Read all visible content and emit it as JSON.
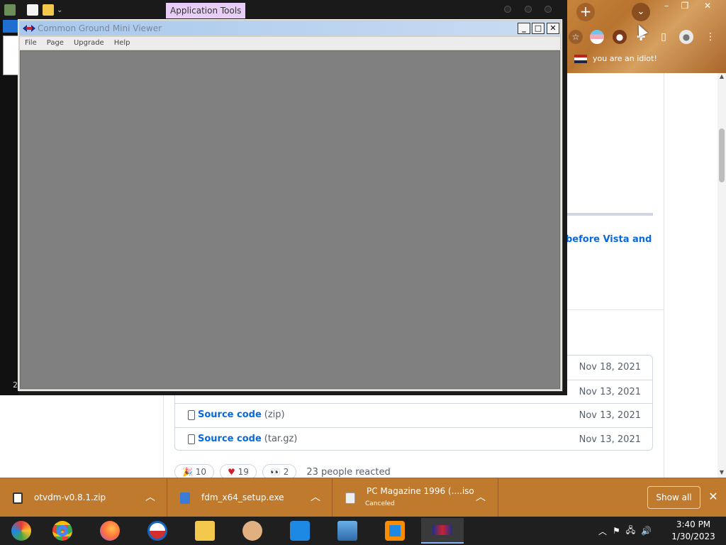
{
  "explorer": {
    "ribbon_context_tab": "Application Tools",
    "status_number": "2"
  },
  "viewer": {
    "title": "Common Ground Mini Viewer",
    "menu": [
      "File",
      "Page",
      "Upgrade",
      "Help"
    ],
    "controls": {
      "minimize": "_",
      "maximize": "□",
      "close": "✕"
    }
  },
  "browser": {
    "bookmark_label": "you are an idiot!",
    "link_fragment": "before Vista and",
    "assets": [
      {
        "name": "",
        "ext": "",
        "date": "Nov 18, 2021"
      },
      {
        "name": "",
        "ext": "",
        "date": "Nov 13, 2021"
      },
      {
        "name": "Source code",
        "ext": "(zip)",
        "date": "Nov 13, 2021"
      },
      {
        "name": "Source code",
        "ext": "(tar.gz)",
        "date": "Nov 13, 2021"
      }
    ],
    "reactions": {
      "tada": "10",
      "heart": "19",
      "eyes": "2",
      "summary": "23 people reacted"
    }
  },
  "downloads": {
    "items": [
      {
        "name": "otvdm-v0.8.1.zip",
        "status": ""
      },
      {
        "name": "fdm_x64_setup.exe",
        "status": ""
      },
      {
        "name": "PC Magazine 1996 (....iso",
        "status": "Canceled"
      }
    ],
    "show_all_label": "Show all"
  },
  "taskbar": {
    "apps": [
      "media-center",
      "chrome",
      "firefox",
      "obama-site",
      "file-explorer",
      "user-app",
      "remote-app",
      "photo-viewer",
      "video-player",
      "common-ground-viewer"
    ],
    "time": "3:40 PM",
    "date": "1/30/2023"
  },
  "colors": {
    "download_bar": "#c07a2e",
    "link_blue": "#0969da",
    "viewer_canvas": "#808080",
    "application_tools_tab": "#e8cdf8"
  }
}
